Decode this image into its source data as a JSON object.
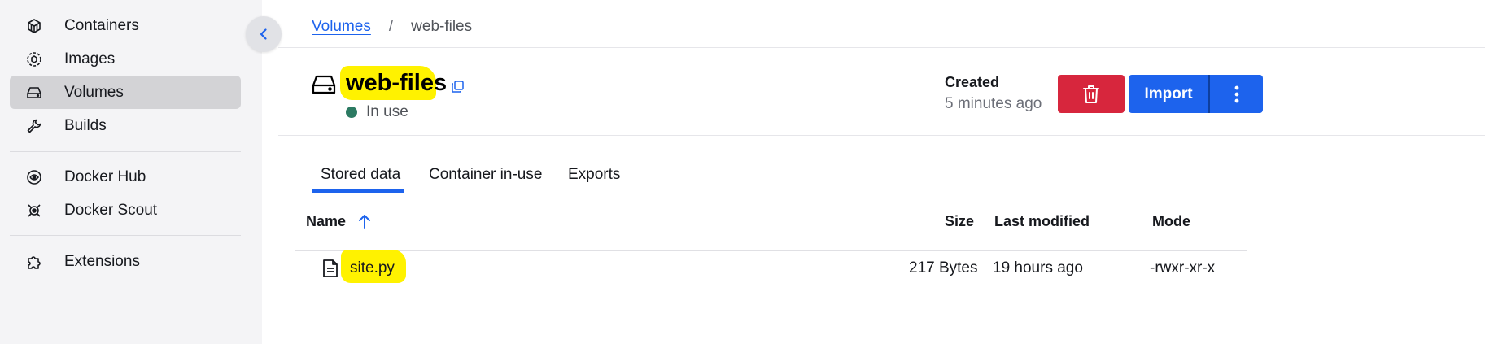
{
  "sidebar": {
    "items": [
      {
        "label": "Containers",
        "icon": "container-icon"
      },
      {
        "label": "Images",
        "icon": "image-icon"
      },
      {
        "label": "Volumes",
        "icon": "volume-icon"
      },
      {
        "label": "Builds",
        "icon": "wrench-icon"
      },
      {
        "label": "Docker Hub",
        "icon": "docker-hub-icon"
      },
      {
        "label": "Docker Scout",
        "icon": "docker-scout-icon"
      },
      {
        "label": "Extensions",
        "icon": "puzzle-icon"
      }
    ],
    "active": "Volumes"
  },
  "breadcrumb": {
    "parent": "Volumes",
    "separator": "/",
    "current": "web-files"
  },
  "volume": {
    "name": "web-files",
    "status": "In use",
    "created_label": "Created",
    "created_value": "5 minutes ago"
  },
  "actions": {
    "import_label": "Import"
  },
  "tabs": [
    {
      "label": "Stored data",
      "active": true
    },
    {
      "label": "Container in-use",
      "active": false
    },
    {
      "label": "Exports",
      "active": false
    }
  ],
  "table": {
    "headers": {
      "name": "Name",
      "size": "Size",
      "modified": "Last modified",
      "mode": "Mode"
    },
    "rows": [
      {
        "name": "site.py",
        "size": "217 Bytes",
        "modified": "19 hours ago",
        "mode": "-rwxr-xr-x"
      }
    ]
  },
  "colors": {
    "accent": "#1d63ed",
    "danger": "#d7263d",
    "status_in_use": "#2c7a62",
    "highlight": "#fff200"
  }
}
